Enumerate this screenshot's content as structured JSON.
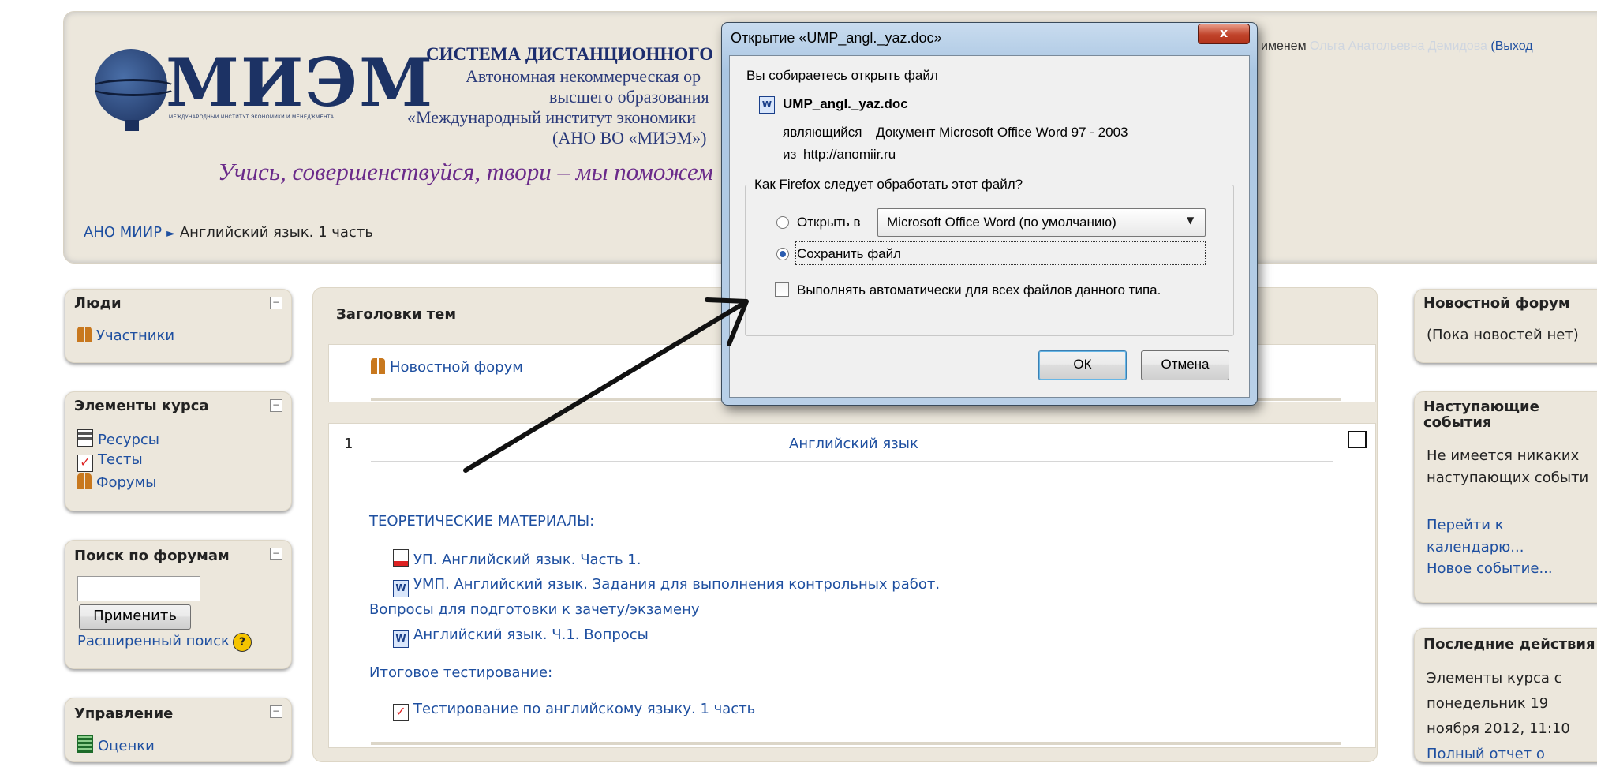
{
  "header": {
    "logo_text": "МИЭМ",
    "logo_subtitle": "МЕЖДУНАРОДНЫЙ ИНСТИТУТ ЭКОНОМИКИ И МЕНЕДЖМЕНТА",
    "system_title": "СИСТЕМА ДИСТАНЦИОННОГО",
    "org_line1": "Автономная некоммерческая ор",
    "org_line2": "высшего образования",
    "org_line3": "«Международный институт экономики",
    "org_line4": "(АНО ВО «МИЭМ»)",
    "motto": "Учись, совершенствуйся, твори – мы поможем",
    "login_prefix": "именем",
    "login_name": "Ольга Анатольевна Демидова",
    "logout": "(Выход"
  },
  "breadcrumb": {
    "home": "АНО МИИР",
    "separator": "►",
    "current": "Английский язык. 1 часть"
  },
  "left_blocks": {
    "people": {
      "title": "Люди",
      "items": [
        "Участники"
      ]
    },
    "course_elements": {
      "title": "Элементы курса",
      "items": [
        "Ресурсы",
        "Тесты",
        "Форумы"
      ]
    },
    "forum_search": {
      "title": "Поиск по форумам",
      "input_value": "",
      "button": "Применить",
      "advanced": "Расширенный поиск"
    },
    "management": {
      "title": "Управление",
      "items": [
        "Оценки"
      ]
    }
  },
  "main": {
    "topics_header": "Заголовки тем",
    "news_forum": "Новостной форум",
    "section_number": "1",
    "section_title": "Английский язык",
    "theory_heading": "ТЕОРЕТИЧЕСКИЕ МАТЕРИАЛЫ:",
    "resource1": "УП. Английский язык. Часть 1.",
    "resource2": "УМП. Английский язык. Задания для выполнения контрольных работ.",
    "questions_heading": "Вопросы для подготовки к зачету/экзамену",
    "resource3": "Английский язык. Ч.1. Вопросы",
    "testing_heading": "Итоговое тестирование:",
    "test1": "Тестирование по английскому языку. 1 часть"
  },
  "right_blocks": {
    "news": {
      "title": "Новостной форум",
      "text": "(Пока новостей нет)"
    },
    "events": {
      "title_line1": "Наступающие",
      "title_line2": "события",
      "text_line1": "Не имеется никаких",
      "text_line2": "наступающих событи",
      "link_calendar_line1": "Перейти к",
      "link_calendar_line2": "календарю...",
      "link_new_event": "Новое событие..."
    },
    "recent": {
      "title": "Последние действия",
      "line1": "Элементы курса с",
      "line2": "понедельник 19",
      "line3": "ноября 2012, 11:10",
      "line4": "Полный отчет о"
    }
  },
  "dialog": {
    "title": "Открытие «UMP_angl._yaz.doc»",
    "close": "x",
    "intro": "Вы собираетесь открыть файл",
    "filename": "UMP_angl._yaz.doc",
    "type_label": "являющийся",
    "type_value": "Документ Microsoft Office Word 97 - 2003",
    "from_label": "из",
    "from_value": "http://anomiir.ru",
    "question": "Как Firefox следует обработать этот файл?",
    "open_with_label": "Открыть в",
    "open_with_app": "Microsoft Office Word (по умолчанию)",
    "save_label": "Сохранить файл",
    "auto_label": "Выполнять автоматически для всех файлов данного типа.",
    "ok": "ОК",
    "cancel": "Отмена"
  }
}
